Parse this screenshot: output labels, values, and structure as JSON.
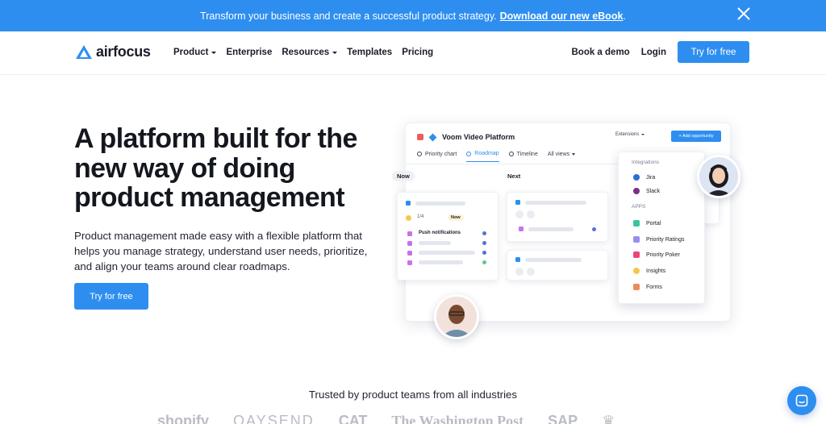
{
  "banner": {
    "text": "Transform your business and create a successful product strategy.",
    "link": "Download our new eBook",
    "suffix": "."
  },
  "nav": {
    "logo": "airfocus",
    "menu": [
      "Product",
      "Enterprise",
      "Resources",
      "Templates",
      "Pricing"
    ],
    "book_demo": "Book a demo",
    "login": "Login",
    "cta": "Try for free"
  },
  "hero": {
    "title_lines": [
      "A platform built for the",
      "new way of doing",
      "product management"
    ],
    "subtitle_lines": [
      "Product management made easy with a flexible platform that",
      "helps you manage strategy, understand user needs, prioritize,",
      "and align your teams around clear roadmaps."
    ],
    "cta": "Try for free"
  },
  "mockup": {
    "workspace": "Voom Video Platform",
    "extensions": "Extensions",
    "add_button": "+ Add opportunity",
    "tabs": [
      "Priority chart",
      "Roadmap",
      "Timeline",
      "All views"
    ],
    "columns": [
      "Now",
      "Next"
    ],
    "card_progress": "1/4",
    "card_badge": "Now",
    "card_item": "Push notifications",
    "integrations_heading": "Integrations",
    "integrations": [
      "Jira",
      "Slack"
    ],
    "apps_heading": "APPS",
    "apps": [
      "Portal",
      "Priority Ratings",
      "Priority Poker",
      "Insights",
      "Forms"
    ]
  },
  "trusted": {
    "heading": "Trusted by product teams from all industries",
    "logos": [
      "shopify",
      "QAYSEND",
      "CAT",
      "The Washington Post",
      "SAP",
      "crown-logo"
    ]
  },
  "colors": {
    "primary": "#2e8ef0",
    "text": "#15171f"
  }
}
